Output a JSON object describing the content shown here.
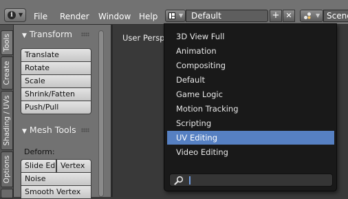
{
  "header": {
    "menus": [
      "File",
      "Render",
      "Window",
      "Help"
    ],
    "layout_value": "Default",
    "add_symbol": "+",
    "remove_symbol": "✕",
    "scene_label": "Scene"
  },
  "tabs": [
    "Tools",
    "Create",
    "Shading / UVs",
    "Options"
  ],
  "tools": {
    "transform_title": "Transform",
    "transform_buttons": [
      "Translate",
      "Rotate",
      "Scale",
      "Shrink/Fatten",
      "Push/Pull"
    ],
    "mesh_title": "Mesh Tools",
    "deform_label": "Deform:",
    "slide_edge": "Slide Ed",
    "vertex": "Vertex",
    "noise": "Noise",
    "smooth_vertex": "Smooth Vertex"
  },
  "viewport": {
    "label": "User Persp"
  },
  "dropdown": {
    "items": [
      "3D View Full",
      "Animation",
      "Compositing",
      "Default",
      "Game Logic",
      "Motion Tracking",
      "Scripting",
      "UV Editing",
      "Video Editing"
    ],
    "selected": "UV Editing",
    "search_value": ""
  },
  "colors": {
    "highlight": "#5680c2",
    "menu_bg": "#191919",
    "header": "#727272"
  }
}
